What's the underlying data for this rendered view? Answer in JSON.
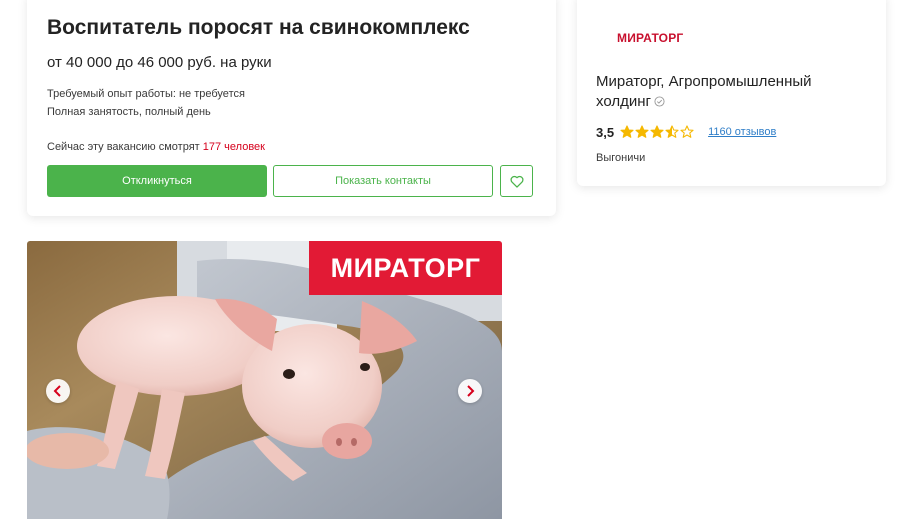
{
  "vacancy": {
    "title": "Воспитатель поросят на свинокомплекс",
    "salary": "от 40 000 до 46 000 руб. на руки",
    "experience": "Требуемый опыт работы: не требуется",
    "employment": "Полная занятость, полный день",
    "viewers_prefix": "Сейчас эту вакансию смотрят ",
    "viewers_count": "177 человек",
    "apply_label": "Откликнуться",
    "contacts_label": "Показать контакты",
    "favorite_icon": "heart-icon"
  },
  "employer": {
    "logo_text": "МИРАТОРГ",
    "name": "Мираторг, Агропромышленный холдинг",
    "verified_icon": "check-circle-icon",
    "rating": "3,5",
    "stars": 3.5,
    "reviews": "1160 отзывов",
    "location": "Выгоничи"
  },
  "carousel": {
    "banner_text": "МИРАТОРГ",
    "prev_icon": "chevron-left-icon",
    "next_icon": "chevron-right-icon"
  },
  "colors": {
    "accent_green": "#4bb34b",
    "brand_red": "#e21a35",
    "link_blue": "#2f7ec8",
    "star_gold": "#f5b800"
  }
}
